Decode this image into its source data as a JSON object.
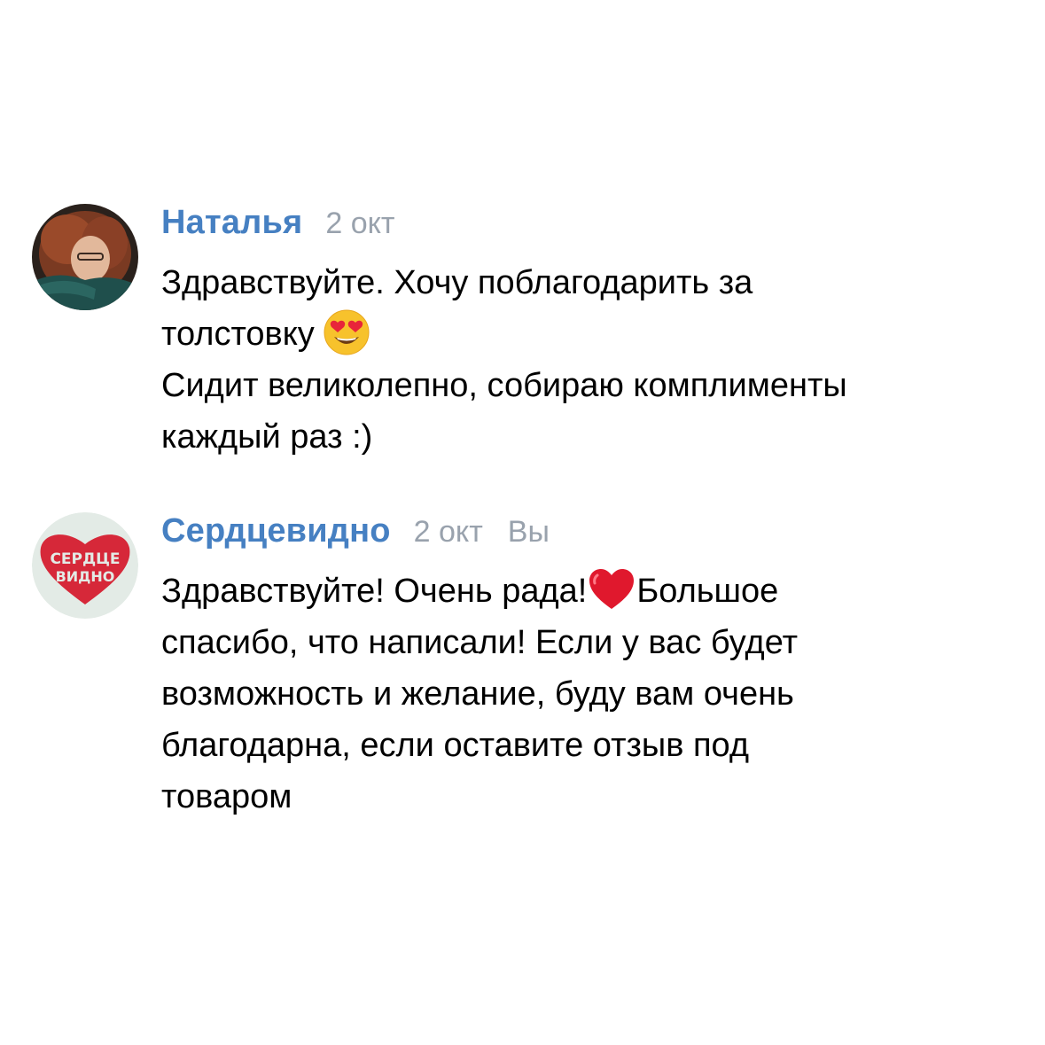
{
  "comments": [
    {
      "author": "Наталья",
      "date": "2 окт",
      "avatar": "user-photo-avatar",
      "lines": [
        "Здравствуйте. Хочу поблагодарить за",
        "толстовку",
        "Сидит великолепно, собираю комплименты",
        "каждый раз :)"
      ],
      "emoji": "heart-eyes-emoji"
    },
    {
      "author": "Сердцевидно",
      "date": "2 окт",
      "badge": "Вы",
      "avatar": "brand-logo-avatar",
      "logo_text": [
        "СЕРДЦЕ",
        "ВИДНО"
      ],
      "lines": [
        "Здравствуйте! Очень рада!",
        "Большое",
        "спасибо, что написали! Если у вас будет",
        "возможность и желание, буду вам очень",
        "благодарна, если оставите отзыв под",
        "товаром"
      ],
      "emoji": "red-heart-emoji"
    }
  ],
  "colors": {
    "author": "#4680c2",
    "meta": "#99a2ad",
    "text": "#000000",
    "background": "#ffffff",
    "logo_red": "#d62839"
  }
}
